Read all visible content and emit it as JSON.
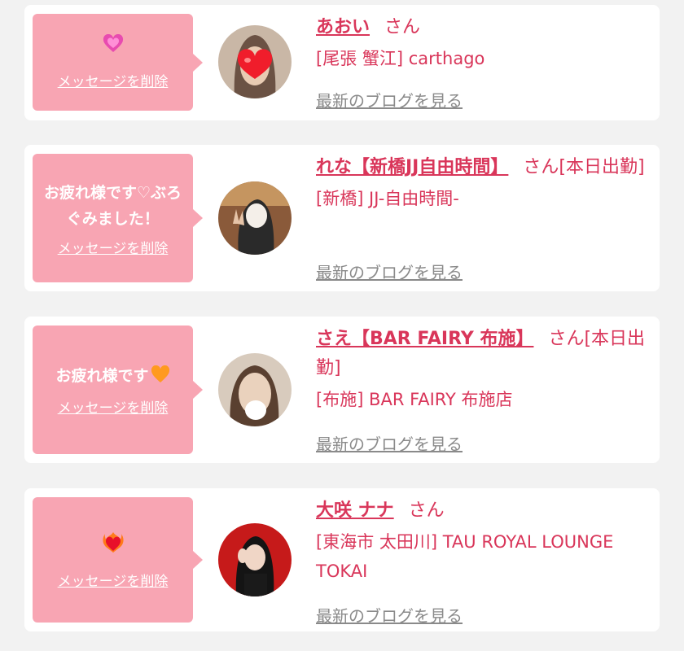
{
  "colors": {
    "accent": "#d9365a",
    "bubble": "#f8a5b3",
    "link_gray": "#8a8a8a"
  },
  "cards": [
    {
      "message": "",
      "emoji_icon": "growing-heart-icon",
      "delete_label": "メッセージを削除",
      "name": "あおい",
      "honorific": "さん",
      "shop": "[尾張 蟹江] carthago",
      "blog_label": "最新のブログを見る",
      "avatar_icon": "heart-covered-face-avatar"
    },
    {
      "message": "お疲れ様です♡ぶろぐみました！",
      "delete_label": "メッセージを削除",
      "name": "れな【新橋JJ自由時間】",
      "honorific": "さん[本日出勤]",
      "shop": "[新橋] JJ-自由時間-",
      "blog_label": "最新のブログを見る",
      "avatar_icon": "peace-sign-avatar"
    },
    {
      "message": "お疲れ様です",
      "emoji_icon": "orange-heart-icon",
      "delete_label": "メッセージを削除",
      "name": "さえ【BAR FAIRY 布施】",
      "honorific": "さん[本日出勤]",
      "shop": "[布施] BAR FAIRY 布施店",
      "blog_label": "最新のブログを見る",
      "avatar_icon": "face-avatar"
    },
    {
      "message": "",
      "emoji_icon": "heart-on-fire-icon",
      "delete_label": "メッセージを削除",
      "name": "大咲 ナナ",
      "honorific": "さん",
      "shop": "[東海市 太田川] TAU ROYAL LOUNGE TOKAI",
      "blog_label": "最新のブログを見る",
      "avatar_icon": "red-background-avatar"
    }
  ]
}
